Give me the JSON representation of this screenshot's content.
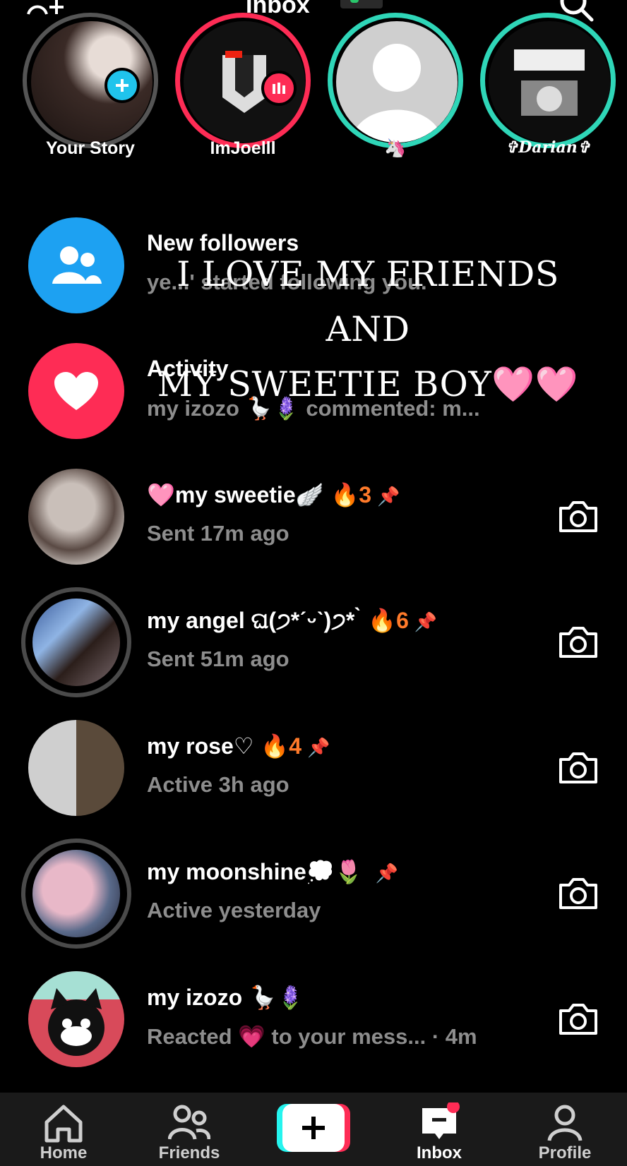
{
  "header": {
    "title": "Inbox"
  },
  "stories": [
    {
      "label": "Your Story"
    },
    {
      "label": "ImJoelll"
    },
    {
      "label": "🦄"
    },
    {
      "label": "✞Darian✞"
    }
  ],
  "caption": {
    "line1": "I LOVE MY FRIENDS AND",
    "line2": "MY SWEETIE BOY",
    "hearts": "🩷🩷"
  },
  "new_followers": {
    "name": "New followers",
    "sub": "ye...' started following you."
  },
  "activity": {
    "name": "Activity",
    "sub": "my izozo 🪿🪻 commented: m..."
  },
  "chats": [
    {
      "name": "🩷my sweetie🪽",
      "streak": "🔥3",
      "pin": "📌",
      "status": "Sent 17m ago"
    },
    {
      "name": "my angel ଘ(੭*ˊᵕˋ)੭* ̀",
      "streak": "🔥6",
      "pin": "📌",
      "status": "Sent 51m ago"
    },
    {
      "name": "my rose♡",
      "streak": "🔥4",
      "pin": "📌",
      "status": "Active 3h ago"
    },
    {
      "name": "my moonshine💭🌷",
      "streak": "",
      "pin": "📌",
      "status": "Active yesterday"
    },
    {
      "name": "my izozo 🪿🪻",
      "streak": "",
      "pin": "",
      "status": "Reacted 💗 to your mess...  · 4m"
    }
  ],
  "nav": [
    {
      "label": "Home"
    },
    {
      "label": "Friends"
    },
    {
      "label": "Inbox"
    },
    {
      "label": "Profile"
    }
  ],
  "colors": {
    "accent_pink": "#fe2c55",
    "accent_cyan": "#25f4ee",
    "blue_icon": "#1da1f2",
    "streak_orange": "#ff7a2a"
  }
}
